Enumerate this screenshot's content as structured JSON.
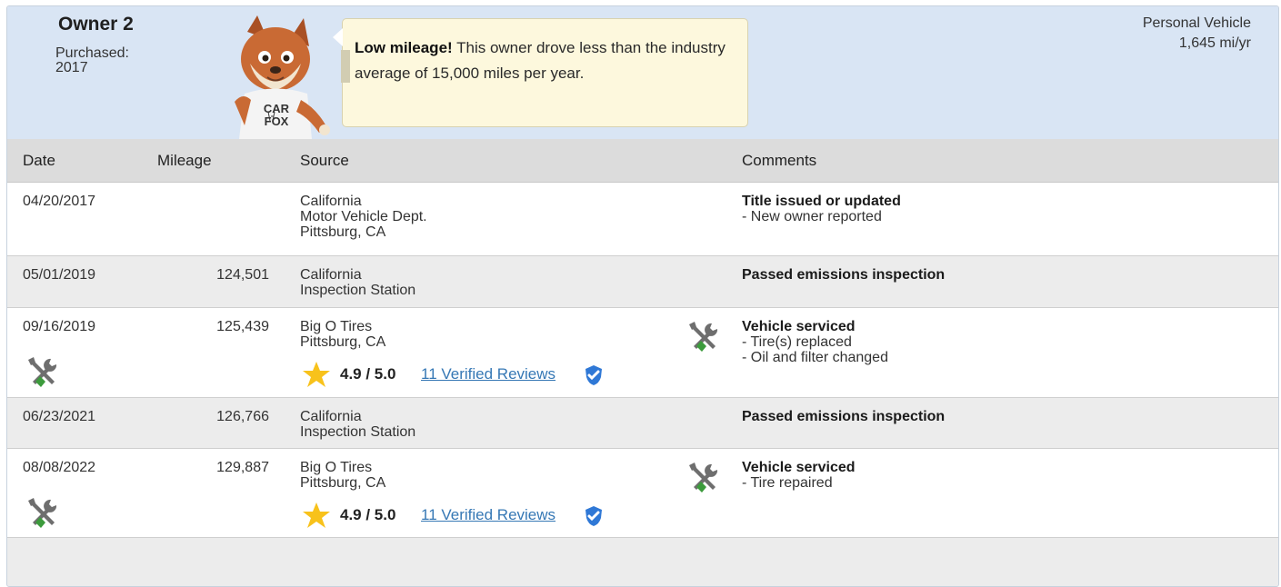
{
  "owner": {
    "title": "Owner 2",
    "purchased_label": "Purchased:",
    "purchased_year": "2017",
    "vehicle_type": "Personal Vehicle",
    "mileage_per_year": "1,645 mi/yr",
    "fox_shirt_text": [
      "CAR",
      "FOX"
    ]
  },
  "callout": {
    "bold": "Low mileage!",
    "text": " This owner drove less than the industry average of 15,000 miles per year."
  },
  "table": {
    "headers": {
      "date": "Date",
      "mileage": "Mileage",
      "source": "Source",
      "comments": "Comments"
    },
    "rows": [
      {
        "date": "04/20/2017",
        "mileage": "",
        "source": [
          "California",
          "Motor Vehicle Dept.",
          "Pittsburg, CA"
        ],
        "comment_title": "Title issued or updated",
        "comment_items": [
          "- New owner reported"
        ]
      },
      {
        "date": "05/01/2019",
        "mileage": "124,501",
        "source": [
          "California",
          "Inspection Station"
        ],
        "comment_title": "Passed emissions inspection",
        "comment_items": []
      },
      {
        "date": "09/16/2019",
        "mileage": "125,439",
        "source": [
          "Big O Tires",
          "Pittsburg, CA"
        ],
        "rating": "4.9 / 5.0",
        "reviews": "11 Verified Reviews",
        "comment_title": "Vehicle serviced",
        "comment_items": [
          "- Tire(s) replaced",
          "- Oil and filter changed"
        ]
      },
      {
        "date": "06/23/2021",
        "mileage": "126,766",
        "source": [
          "California",
          "Inspection Station"
        ],
        "comment_title": "Passed emissions inspection",
        "comment_items": []
      },
      {
        "date": "08/08/2022",
        "mileage": "129,887",
        "source": [
          "Big O Tires",
          "Pittsburg, CA"
        ],
        "rating": "4.9 / 5.0",
        "reviews": "11 Verified Reviews",
        "comment_title": "Vehicle serviced",
        "comment_items": [
          "- Tire repaired"
        ]
      }
    ]
  },
  "colors": {
    "header_bg": "#d9e5f4",
    "callout_bg": "#fdf8dd",
    "link": "#3678b5",
    "star": "#f8c21b",
    "badge": "#2f78d6",
    "tool_green": "#3c9b3c"
  }
}
